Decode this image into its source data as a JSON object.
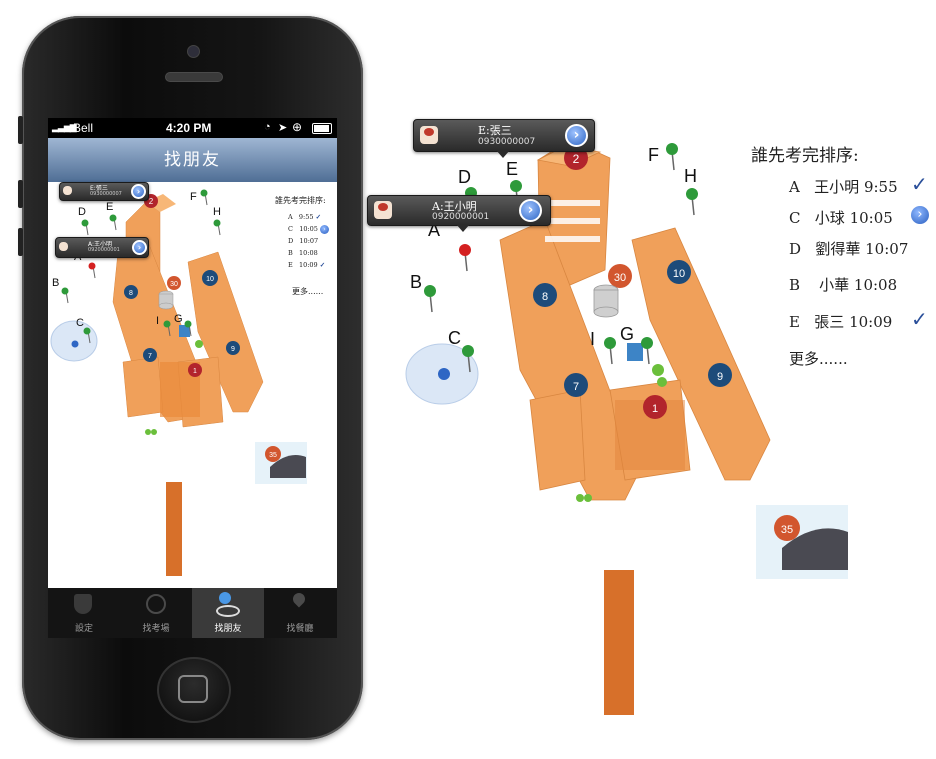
{
  "phone": {
    "status": {
      "carrier": "Bell",
      "time": "4:20 PM"
    },
    "nav_title": "找朋友",
    "bubble_e": {
      "name": "E:張三",
      "phone": "0930000007"
    },
    "bubble_a": {
      "name": "A:王小明",
      "phone": "0920000001"
    },
    "pins": {
      "A": "A",
      "B": "B",
      "C": "C",
      "D": "D",
      "E": "E",
      "F": "F",
      "G": "G",
      "H": "H",
      "I": "I"
    },
    "buildings": {
      "b2": "2",
      "b8": "8",
      "b30": "30",
      "b10": "10",
      "b7": "7",
      "b9": "9",
      "b1": "1",
      "b35": "35"
    },
    "ranking": {
      "title": "誰先考完排序:",
      "items": [
        {
          "letter": "A",
          "time": "9:55"
        },
        {
          "letter": "C",
          "time": "10:05"
        },
        {
          "letter": "D",
          "time": "10:07"
        },
        {
          "letter": "B",
          "time": "10:08"
        },
        {
          "letter": "E",
          "time": "10:09"
        }
      ],
      "more": "更多......"
    },
    "tabs": [
      {
        "label": "設定",
        "icon": "shield-icon"
      },
      {
        "label": "找考場",
        "icon": "compass-icon"
      },
      {
        "label": "找朋友",
        "icon": "friend-pin-icon"
      },
      {
        "label": "找餐廳",
        "icon": "location-pin-icon"
      }
    ]
  },
  "detail": {
    "bubble_e": {
      "name": "E:張三",
      "phone": "0930000007"
    },
    "bubble_a": {
      "name": "A:王小明",
      "phone": "0920000001"
    },
    "pins": {
      "A": "A",
      "B": "B",
      "C": "C",
      "D": "D",
      "E": "E",
      "F": "F",
      "G": "G",
      "H": "H",
      "I": "I"
    },
    "buildings": {
      "b2": "2",
      "b8": "8",
      "b30": "30",
      "b10": "10",
      "b7": "7",
      "b9": "9",
      "b1": "1",
      "b35": "35"
    },
    "ranking": {
      "title": "誰先考完排序:",
      "items": [
        {
          "letter": "A",
          "name": "王小明",
          "time": "9:55",
          "status": "check"
        },
        {
          "letter": "C",
          "name": "小球",
          "time": "10:05",
          "status": "info"
        },
        {
          "letter": "D",
          "name": "劉得華",
          "time": "10:07",
          "status": ""
        },
        {
          "letter": "B",
          "name": "小華",
          "time": "10:08",
          "status": ""
        },
        {
          "letter": "E",
          "name": "張三",
          "time": "10:09",
          "status": "check"
        }
      ],
      "more": "更多......"
    }
  },
  "colors": {
    "pin_green": "#2e9a3a",
    "pin_red": "#d42020",
    "building": "#f2a25a",
    "circle_dark": "#2a4f7a",
    "nav_blue": "#6f8db4"
  }
}
